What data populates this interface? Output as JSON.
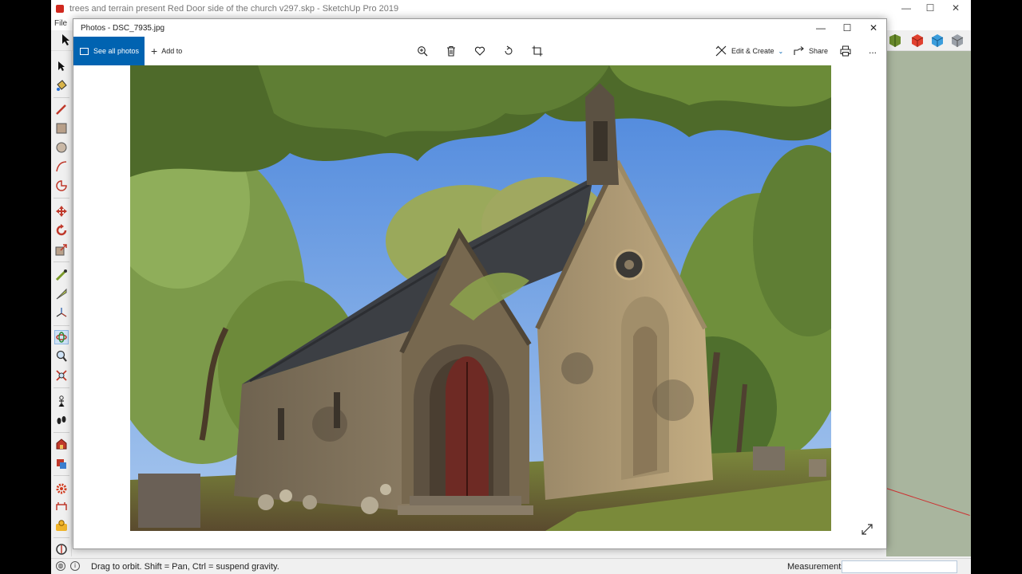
{
  "sketchup": {
    "title": "trees and terrain present Red Door side of the church v297.skp - SketchUp Pro 2019",
    "menu_file": "File",
    "status_text": "Drag to orbit. Shift = Pan, Ctrl = suspend gravity.",
    "measurements_label": "Measurements",
    "measurements_value": ""
  },
  "photos": {
    "title": "Photos - DSC_7935.jpg",
    "see_all_label": "See all photos",
    "add_to_label": "Add to",
    "edit_create_label": "Edit & Create",
    "share_label": "Share",
    "more_label": "...",
    "photo_subject": "stone church with arched red door under trees"
  },
  "colors": {
    "accent": "#0063b1",
    "viewport": "#a9b59e",
    "sky": "#5b93de",
    "foliage": "#6f8f3c",
    "stone": "#8b7a5e",
    "roof": "#3c3f44",
    "door": "#6e2a24"
  }
}
